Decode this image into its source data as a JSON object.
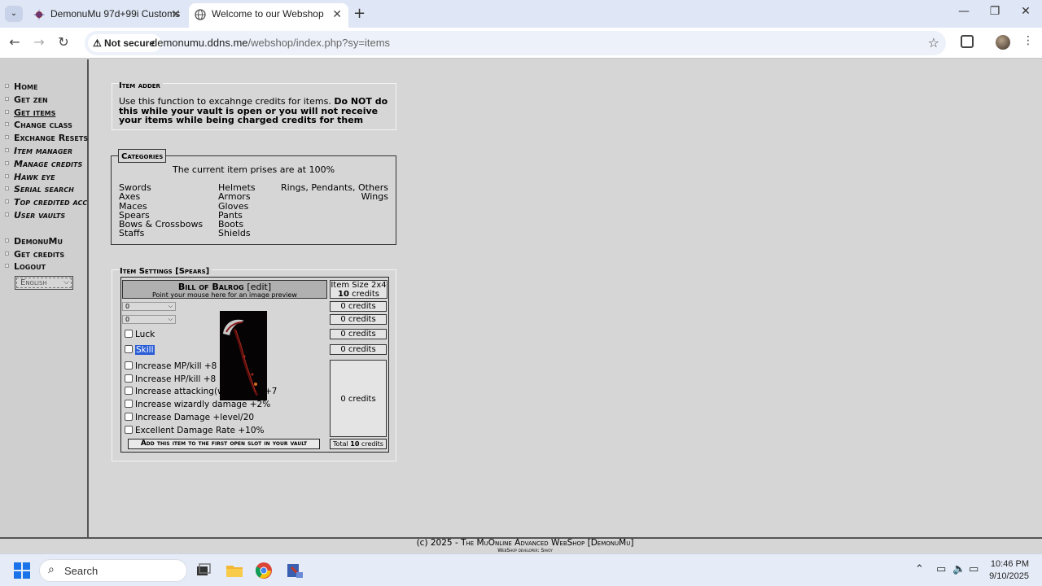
{
  "browser": {
    "tabs": [
      {
        "title": "DemonuMu 97d+99i Customs",
        "active": false
      },
      {
        "title": "Welcome to our Webshop",
        "active": true
      }
    ],
    "security_label": "Not secure",
    "url_host": "demonumu.ddns.me",
    "url_path": "/webshop/index.php?sy=items"
  },
  "sidebar": {
    "items": [
      {
        "label": "Home"
      },
      {
        "label": "Get zen"
      },
      {
        "label": "Get items"
      },
      {
        "label": "Change class"
      },
      {
        "label": "Exchange Resets"
      },
      {
        "label": "Item manager"
      },
      {
        "label": "Manage credits"
      },
      {
        "label": "Hawk eye"
      },
      {
        "label": "Serial search"
      },
      {
        "label": "Top credited acc"
      },
      {
        "label": "User vaults"
      }
    ],
    "items2": [
      {
        "label": "DemonuMu"
      },
      {
        "label": "Get credits"
      },
      {
        "label": "Logout"
      }
    ],
    "language": "English"
  },
  "item_adder": {
    "title": "Item adder",
    "text": "Use this function to excahnge credits for items. ",
    "warning": "Do NOT do this while your vault is open or you will not receive your items while being charged credits for them"
  },
  "categories": {
    "title": "Categories",
    "header": "The current item prises are at 100%",
    "col1": [
      "Swords",
      "Axes",
      "Maces",
      "Spears",
      "Bows & Crossbows",
      "Staffs"
    ],
    "col2": [
      "Helmets",
      "Armors",
      "Gloves",
      "Pants",
      "Boots",
      "Shields"
    ],
    "col3": [
      "Rings, Pendants, Others",
      "Wings"
    ]
  },
  "item_settings": {
    "title": "Item Settings [Spears]",
    "item_name": "Bill of Balrog",
    "edit_label": "[edit]",
    "hint": "Point your mouse here for an image preview",
    "size_label": "Item Size 2x4",
    "size_credits": "10",
    "size_credits_unit": " credits",
    "dropdown1": "0",
    "dropdown2": "0",
    "credits_level": "0 credits",
    "credits_option": "0 credits",
    "credits_luck": "0 credits",
    "credits_skill": "0 credits",
    "credits_excellent": "0 credits",
    "luck_label": "Luck",
    "skill_label": "Skill",
    "excellent_options": [
      "Increase MP/kill +8",
      "Increase HP/kill +8",
      "Increase attacking(wizardly)speed+7",
      "Increase wizardly damage +2%",
      "Increase Damage +level/20",
      "Excellent Damage Rate +10%"
    ],
    "visible_options": [
      "Increase MP/kill +8",
      "Increase HP/kill +8",
      "Increase attacking(wiz",
      "Increase wizardly damage +2%",
      "Increase Damage +level/20",
      "Excellent Damage Rate +10%"
    ],
    "option3_tail": "+7",
    "add_button": "Add this item to the first open slot in your vault",
    "total_label": "Total ",
    "total_value": "10",
    "total_unit": " credits"
  },
  "footer": {
    "prefix": "(c) 2025 - ",
    "name": "The MuOnline Advanced WebShop [DemonuMu]",
    "developer": "WebShop developer: Savoy"
  },
  "taskbar": {
    "search_placeholder": "Search",
    "time": "10:46 PM",
    "date": "9/10/2025"
  },
  "colors": {
    "page_bg": "#d6d6d6",
    "selection": "#2a5dd6",
    "item_image_bg": "#050304"
  }
}
